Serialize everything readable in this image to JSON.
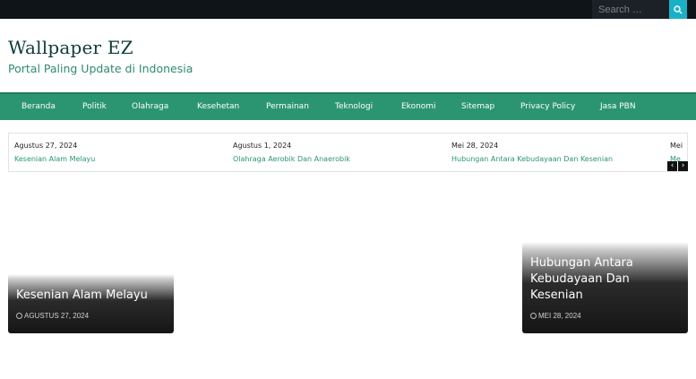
{
  "search": {
    "placeholder": "Search …"
  },
  "header": {
    "title": "Wallpaper EZ",
    "tagline": "Portal Paling Update di Indonesia"
  },
  "nav": {
    "items": [
      "Beranda",
      "Politik",
      "Olahraga",
      "Kesehetan",
      "Permainan",
      "Teknologi",
      "Ekonomi",
      "Sitemap",
      "Privacy Policy",
      "Jasa PBN"
    ]
  },
  "ticker": {
    "items": [
      {
        "date": "Agustus 27, 2024",
        "title": "Kesenian Alam Melayu"
      },
      {
        "date": "Agustus 1, 2024",
        "title": "Olahraga Aerobik Dan Anaerobik"
      },
      {
        "date": "Mei 28, 2024",
        "title": "Hubungan Antara Kebudayaan Dan Kesenian"
      },
      {
        "date": "Mei",
        "title": "Me"
      }
    ],
    "prev": "‹",
    "next": "›"
  },
  "cards": [
    {
      "title": "Kesenian Alam Melayu",
      "date": "AGUSTUS 27, 2024"
    },
    {
      "title": "Hubungan Antara Kebudayaan Dan Kesenian",
      "date": "MEI 28, 2024"
    }
  ],
  "colors": {
    "accent": "#2b9572",
    "search_button": "#1ab1c7",
    "topbar": "#0f1419",
    "title": "#0d3b3a"
  }
}
